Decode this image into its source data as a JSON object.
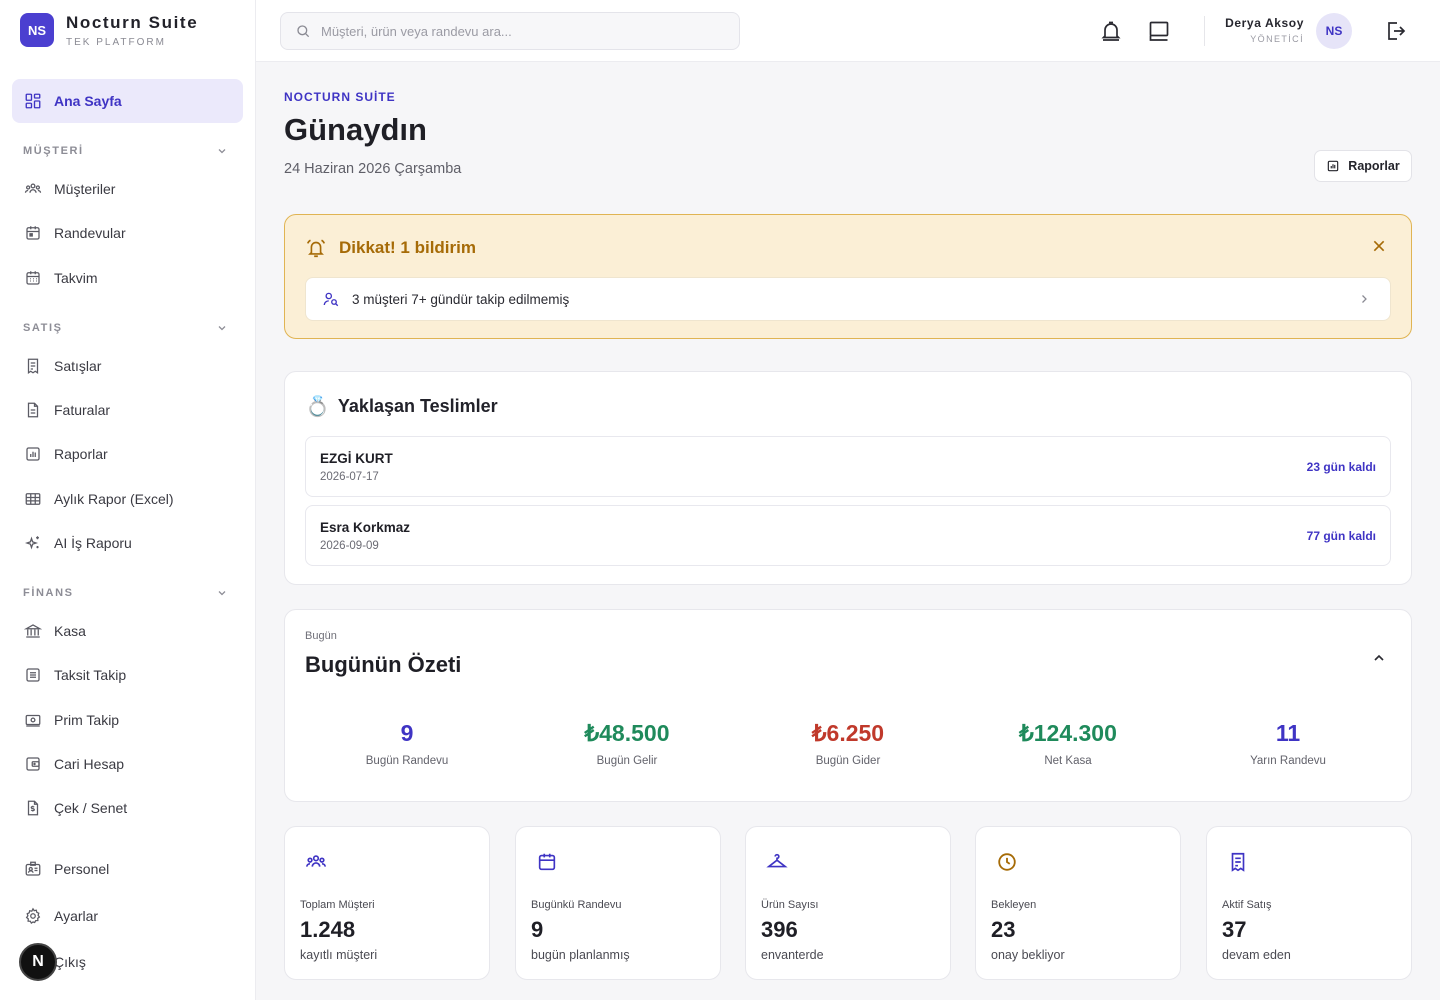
{
  "brand": {
    "initials": "NS",
    "name": "Nocturn Suite",
    "subtitle": "TEK PLATFORM"
  },
  "colors": {
    "accent": "#3f34c4",
    "warning": "#a66b07",
    "income": "#1f8a5b",
    "expense": "#c0392b"
  },
  "sidebar": {
    "home": {
      "label": "Ana Sayfa",
      "icon": "dashboard-icon"
    },
    "sections": [
      {
        "title": "MÜŞTERİ",
        "items": [
          {
            "label": "Müşteriler",
            "icon": "users-icon"
          },
          {
            "label": "Randevular",
            "icon": "calendar-icon"
          },
          {
            "label": "Takvim",
            "icon": "calendar-grid-icon"
          }
        ]
      },
      {
        "title": "SATIŞ",
        "items": [
          {
            "label": "Satışlar",
            "icon": "receipt-icon"
          },
          {
            "label": "Faturalar",
            "icon": "document-icon"
          },
          {
            "label": "Raporlar",
            "icon": "chart-icon"
          },
          {
            "label": "Aylık Rapor (Excel)",
            "icon": "table-icon"
          },
          {
            "label": "AI İş Raporu",
            "icon": "sparkles-icon"
          }
        ]
      },
      {
        "title": "FİNANS",
        "items": [
          {
            "label": "Kasa",
            "icon": "bank-icon"
          },
          {
            "label": "Taksit Takip",
            "icon": "list-icon"
          },
          {
            "label": "Prim Takip",
            "icon": "cash-icon"
          },
          {
            "label": "Cari Hesap",
            "icon": "wallet-icon"
          },
          {
            "label": "Çek / Senet",
            "icon": "bill-icon"
          }
        ]
      }
    ],
    "bottom": [
      {
        "label": "Personel",
        "icon": "id-card-icon"
      },
      {
        "label": "Ayarlar",
        "icon": "gear-icon"
      },
      {
        "label": "Çıkış",
        "icon": "logout-icon"
      }
    ],
    "badge": "N"
  },
  "topbar": {
    "search_placeholder": "Müşteri, ürün veya randevu ara...",
    "user_name": "Derya Aksoy",
    "user_role": "YÖNETİCİ",
    "avatar": "NS"
  },
  "header": {
    "eyebrow": "NOCTURN SUİTE",
    "title": "Günaydın",
    "date": "24 Haziran 2026 Çarşamba",
    "report_button": "Raporlar"
  },
  "alert": {
    "title": "Dikkat! 1 bildirim",
    "message": "3 müşteri 7+ gündür takip edilmemiş"
  },
  "deliveries": {
    "icon": "💍",
    "title": "Yaklaşan Teslimler",
    "items": [
      {
        "name": "EZGİ KURT",
        "date": "2026-07-17",
        "remaining": "23 gün kaldı"
      },
      {
        "name": "Esra Korkmaz",
        "date": "2026-09-09",
        "remaining": "77 gün kaldı"
      }
    ]
  },
  "summary": {
    "subtitle": "Bugün",
    "title": "Bugünün Özeti",
    "stats": [
      {
        "value": "9",
        "label": "Bugün Randevu",
        "color": "#3f34c4"
      },
      {
        "value": "₺48.500",
        "label": "Bugün Gelir",
        "color": "#1f8a5b"
      },
      {
        "value": "₺6.250",
        "label": "Bugün Gider",
        "color": "#c0392b"
      },
      {
        "value": "₺124.300",
        "label": "Net Kasa",
        "color": "#1f8a5b"
      },
      {
        "value": "11",
        "label": "Yarın Randevu",
        "color": "#3f34c4"
      }
    ]
  },
  "kpis": [
    {
      "label": "Toplam Müşteri",
      "value": "1.248",
      "sub": "kayıtlı müşteri",
      "icon": "users-icon",
      "color": "#3f34c4"
    },
    {
      "label": "Bugünkü Randevu",
      "value": "9",
      "sub": "bugün planlanmış",
      "icon": "calendar-icon",
      "color": "#3f34c4"
    },
    {
      "label": "Ürün Sayısı",
      "value": "396",
      "sub": "envanterde",
      "icon": "hanger-icon",
      "color": "#3f34c4"
    },
    {
      "label": "Bekleyen",
      "value": "23",
      "sub": "onay bekliyor",
      "icon": "clock-icon",
      "color": "#a66b07"
    },
    {
      "label": "Aktif Satış",
      "value": "37",
      "sub": "devam eden",
      "icon": "receipt-icon",
      "color": "#3f34c4"
    }
  ]
}
